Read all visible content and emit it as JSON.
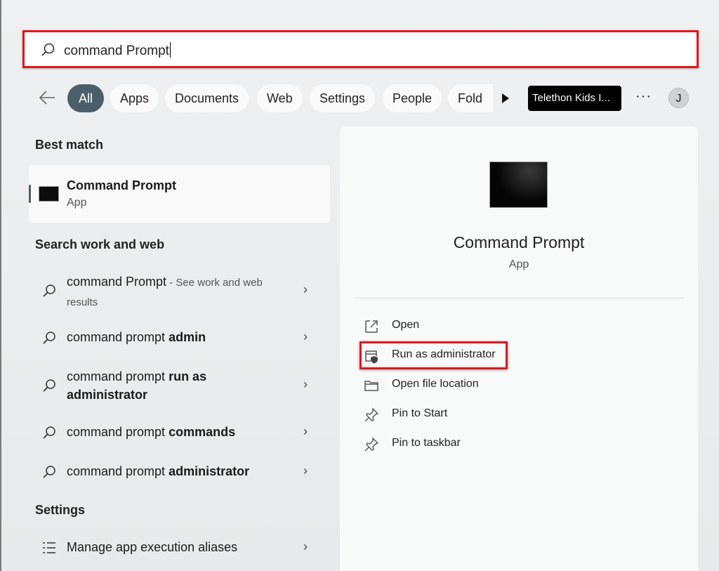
{
  "search": {
    "value": "command Prompt"
  },
  "filters": [
    "All",
    "Apps",
    "Documents",
    "Web",
    "Settings",
    "People",
    "Fold"
  ],
  "org_label": "Telethon Kids I...",
  "more_label": "···",
  "avatar_initial": "J",
  "best_match": {
    "heading": "Best match",
    "title": "Command Prompt",
    "subtitle": "App"
  },
  "search_web": {
    "heading": "Search work and web",
    "items": [
      {
        "prefix": "command Prompt",
        "bold": "",
        "suffix": " - See work and web results"
      },
      {
        "prefix": "command prompt ",
        "bold": "admin",
        "suffix": ""
      },
      {
        "prefix": "command prompt ",
        "bold": "run as administrator",
        "suffix": ""
      },
      {
        "prefix": "command prompt ",
        "bold": "commands",
        "suffix": ""
      },
      {
        "prefix": "command prompt ",
        "bold": "administrator",
        "suffix": ""
      }
    ]
  },
  "settings": {
    "heading": "Settings",
    "items": [
      {
        "label": "Manage app execution aliases"
      }
    ]
  },
  "detail": {
    "title": "Command Prompt",
    "subtitle": "App",
    "actions": [
      {
        "label": "Open",
        "icon": "open-external-icon"
      },
      {
        "label": "Run as administrator",
        "icon": "shield-window-icon"
      },
      {
        "label": "Open file location",
        "icon": "folder-icon"
      },
      {
        "label": "Pin to Start",
        "icon": "pin-icon"
      },
      {
        "label": "Pin to taskbar",
        "icon": "pin-icon"
      }
    ]
  },
  "colors": {
    "highlight": "#e0161e",
    "accent": "#4b5f6b"
  }
}
